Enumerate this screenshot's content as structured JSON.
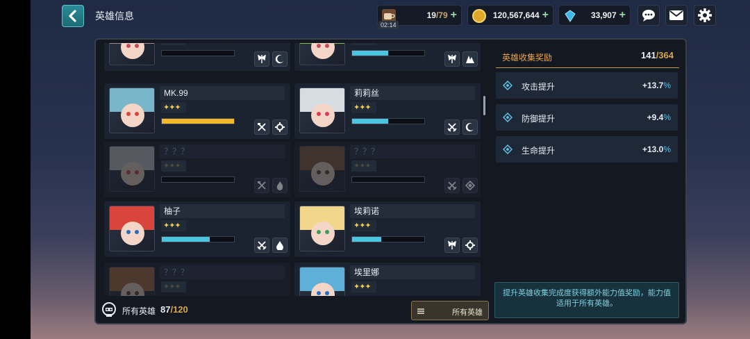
{
  "header": {
    "title": "英雄信息",
    "stamina": {
      "current": "19",
      "max": "/79",
      "timer": "02:14"
    },
    "gold": "120,567,644",
    "gems": "33,907"
  },
  "heroes": [
    {
      "name": "",
      "stars": "✦✦✦",
      "locked": false,
      "progress": 0,
      "bar_color": "#4ec5e0",
      "portrait": {
        "hair": "#9a8c96",
        "eyes": "#c64a5a"
      },
      "skills": [
        "wing-icon",
        "moon-icon"
      ]
    },
    {
      "name": "",
      "stars": "✦✦✦",
      "locked": false,
      "progress": 0.5,
      "bar_color": "#4ec5e0",
      "portrait": {
        "hair": "#7fbf4a",
        "eyes": "#c64a5a"
      },
      "skills": [
        "wing-icon",
        "claw-icon"
      ]
    },
    {
      "name": "MK.99",
      "stars": "✦✦✦",
      "locked": false,
      "progress": 1.0,
      "bar_color": "#f2b82a",
      "portrait": {
        "hair": "#7ab6c9",
        "eyes": "#d9453c"
      },
      "skills": [
        "crossed-hammers-icon",
        "gear-icon"
      ]
    },
    {
      "name": "莉莉丝",
      "stars": "✦✦✦",
      "locked": false,
      "progress": 0.5,
      "bar_color": "#4ec5e0",
      "portrait": {
        "hair": "#d7dce3",
        "eyes": "#d93b5a"
      },
      "skills": [
        "crossed-swords-icon",
        "moon-icon"
      ]
    },
    {
      "name": "？？？",
      "stars": "✦✦✦",
      "locked": true,
      "progress": 0,
      "bar_color": "#4ec5e0",
      "portrait": {
        "hair": "#c9c9c9",
        "eyes": "#d9453c"
      },
      "skills": [
        "crossed-hammers-icon",
        "flame-icon"
      ]
    },
    {
      "name": "？？？",
      "stars": "✦✦✦",
      "locked": true,
      "progress": 0,
      "bar_color": "#4ec5e0",
      "portrait": {
        "hair": "#8a5a3a",
        "eyes": "#6a3a2a"
      },
      "skills": [
        "crossed-swords-icon",
        "diamond-icon"
      ]
    },
    {
      "name": "柚子",
      "stars": "✦✦✦",
      "locked": false,
      "progress": 0.66,
      "bar_color": "#4ec5e0",
      "portrait": {
        "hair": "#d9453c",
        "eyes": "#2a6cbf"
      },
      "skills": [
        "crossed-swords-icon",
        "drop-icon"
      ]
    },
    {
      "name": "埃莉诺",
      "stars": "✦✦✦",
      "locked": false,
      "progress": 0.4,
      "bar_color": "#4ec5e0",
      "portrait": {
        "hair": "#f2d68a",
        "eyes": "#3f9a5a"
      },
      "skills": [
        "wing-icon",
        "gear-icon"
      ]
    },
    {
      "name": "？？？",
      "stars": "✦✦✦",
      "locked": true,
      "progress": 0,
      "bar_color": "#4ec5e0",
      "portrait": {
        "hair": "#b06a3a",
        "eyes": "#6a3a2a"
      },
      "skills": []
    },
    {
      "name": "埃里娜",
      "stars": "✦✦✦",
      "locked": false,
      "progress": 0,
      "bar_color": "#4ec5e0",
      "portrait": {
        "hair": "#5fb0d9",
        "eyes": "#2a6cbf"
      },
      "skills": []
    }
  ],
  "footer": {
    "all_heroes_label": "所有英雄",
    "owned": "87",
    "total": "/120",
    "filter_label": "所有英雄"
  },
  "rewards": {
    "title": "英雄收集奖励",
    "count": "141",
    "total": "/364",
    "stats": [
      {
        "label": "攻击提升",
        "value": "+13.7",
        "unit": "%"
      },
      {
        "label": "防御提升",
        "value": "+9.4",
        "unit": "%"
      },
      {
        "label": "生命提升",
        "value": "+13.0",
        "unit": "%"
      }
    ],
    "info": "提升英雄收集完成度获得额外能力值奖励，能力值适用于所有英雄。"
  },
  "colors": {
    "accent": "#e8a34a",
    "cyan": "#5fc3e8",
    "gold": "#d9a54b"
  }
}
